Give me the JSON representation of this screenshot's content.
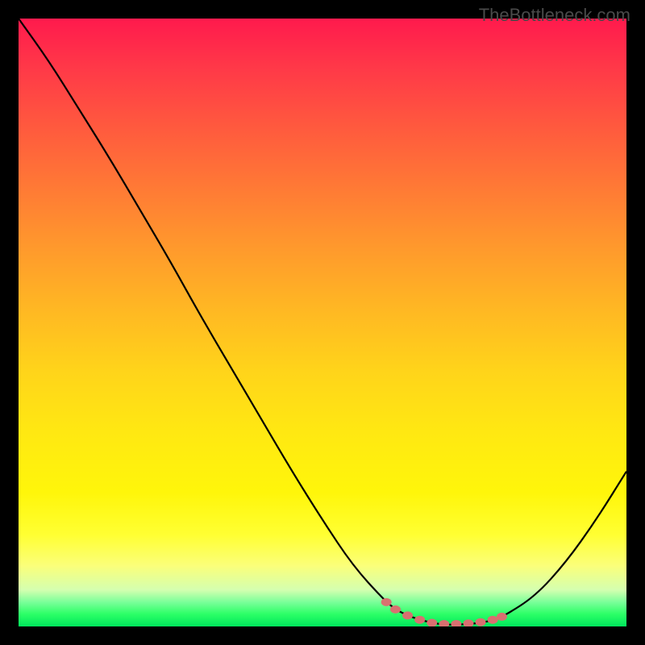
{
  "watermark": "TheBottleneck.com",
  "chart_data": {
    "type": "line",
    "title": "",
    "xlabel": "",
    "ylabel": "",
    "xlim": [
      0,
      100
    ],
    "ylim": [
      0,
      100
    ],
    "series": [
      {
        "name": "curve",
        "x": [
          0,
          5,
          10,
          15,
          20,
          25,
          30,
          35,
          40,
          45,
          50,
          55,
          60,
          62,
          64,
          66,
          68,
          70,
          72,
          74,
          76,
          78,
          80,
          85,
          90,
          95,
          100
        ],
        "y": [
          100,
          93,
          85,
          77,
          68.5,
          60,
          51,
          42.5,
          34,
          25.5,
          17.5,
          10,
          4.5,
          2.8,
          1.8,
          1.1,
          0.6,
          0.3,
          0.3,
          0.4,
          0.6,
          1.0,
          1.8,
          5.0,
          10.5,
          17.5,
          25.5
        ]
      }
    ],
    "markers": {
      "name": "highlight-points",
      "color": "#d87070",
      "x": [
        60.5,
        62,
        64,
        66,
        68,
        70,
        72,
        74,
        76,
        78,
        79.5
      ],
      "y": [
        4.0,
        2.8,
        1.8,
        1.1,
        0.6,
        0.4,
        0.4,
        0.5,
        0.7,
        1.1,
        1.6
      ]
    }
  }
}
